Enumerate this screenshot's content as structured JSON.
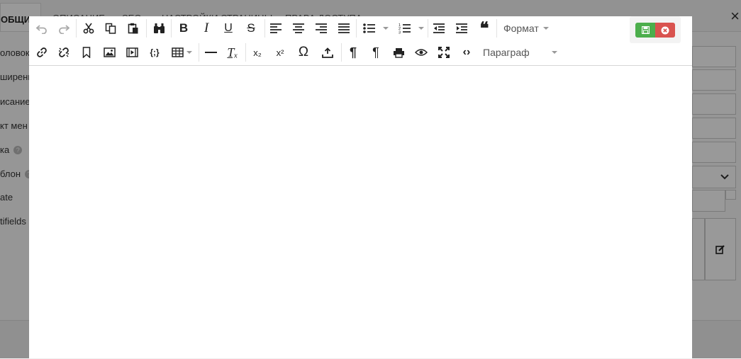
{
  "background": {
    "tabs": [
      {
        "label": "ОБЩИЕ"
      },
      {
        "label": "ОПИСАНИЕ"
      },
      {
        "label": "SEO"
      },
      {
        "label": "НАСТРОЙКИ СТРАНИЦЫ"
      },
      {
        "label": "ПРАВА ДОСТУПА"
      }
    ],
    "close_glyph": "×",
    "labels": [
      {
        "text": "оловок"
      },
      {
        "text": "ширенн"
      },
      {
        "text": "исание"
      },
      {
        "text": "кт мен"
      },
      {
        "text": "ка"
      },
      {
        "text": "блон"
      },
      {
        "text": "ate"
      },
      {
        "text": "tifields"
      }
    ],
    "help_glyph": "?"
  },
  "toolbar": {
    "format_label": "Формат",
    "paragraph_label": "Параграф",
    "bold_glyph": "B",
    "italic_glyph": "I",
    "underline_glyph": "U",
    "strike_glyph": "S",
    "quote_glyph": "❝",
    "pilcrow_glyph": "¶",
    "omega_glyph": "Ω",
    "code_glyph": "‹›",
    "source_glyph": "{;}",
    "sub_glyph": "x₂",
    "sup_glyph": "x²",
    "clear_glyph": "Tₓ"
  },
  "editor": {
    "content": ""
  },
  "colors": {
    "save": "#4cae4c",
    "cancel": "#d9534f"
  }
}
